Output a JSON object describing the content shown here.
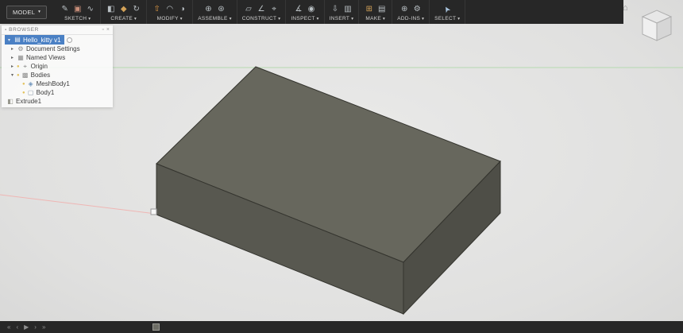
{
  "ui": {
    "caret": "▾",
    "arrow_collapsed": "▸",
    "arrow_expanded": "▾",
    "bulb": {
      "glyph": "●",
      "color": "#e3c25c"
    }
  },
  "colors": {
    "toolbar_bg": "#272727",
    "timeline_bg": "#272727",
    "canvas_bg": "#e4e4e3",
    "selection": "#4a80c4",
    "box_top": "#67675d",
    "box_front": "#585850",
    "box_right": "#4e4e47",
    "box_edge": "#34342e",
    "axis_x": "#efb6b4",
    "axis_z": "#b5d9b0",
    "viewcube_top": "#e9e9e9",
    "viewcube_front": "#f3f3f3",
    "viewcube_right": "#d6d6d6"
  },
  "toolbar": {
    "workspace_label": "MODEL",
    "groups": [
      {
        "label": "SKETCH",
        "icons": [
          {
            "glyph": "✎",
            "color": "#b9c0c4"
          },
          {
            "glyph": "▣",
            "color": "#c98f7a"
          },
          {
            "glyph": "∿",
            "color": "#b9c0c4"
          }
        ]
      },
      {
        "label": "CREATE",
        "icons": [
          {
            "glyph": "◧",
            "color": "#b9c0c4"
          },
          {
            "glyph": "◆",
            "color": "#d3a258"
          },
          {
            "glyph": "↻",
            "color": "#b9c0c4"
          }
        ]
      },
      {
        "label": "MODIFY",
        "icons": [
          {
            "glyph": "⇧",
            "color": "#e09a44"
          },
          {
            "glyph": "◠",
            "color": "#b9c0c4"
          },
          {
            "glyph": "◑",
            "color": "#b9c0c4"
          }
        ]
      },
      {
        "label": "ASSEMBLE",
        "icons": [
          {
            "glyph": "⊕",
            "color": "#b9c0c4"
          },
          {
            "glyph": "⊛",
            "color": "#b9c0c4"
          }
        ]
      },
      {
        "label": "CONSTRUCT",
        "icons": [
          {
            "glyph": "▱",
            "color": "#b9c0c4"
          },
          {
            "glyph": "∠",
            "color": "#b9c0c4"
          },
          {
            "glyph": "⌖",
            "color": "#b9c0c4"
          }
        ]
      },
      {
        "label": "INSPECT",
        "icons": [
          {
            "glyph": "∡",
            "color": "#b9c0c4"
          },
          {
            "glyph": "◉",
            "color": "#b9c0c4"
          }
        ]
      },
      {
        "label": "INSERT",
        "icons": [
          {
            "glyph": "⇩",
            "color": "#b9c0c4"
          },
          {
            "glyph": "▥",
            "color": "#b9c0c4"
          }
        ]
      },
      {
        "label": "MAKE",
        "icons": [
          {
            "glyph": "⊞",
            "color": "#d3a258"
          },
          {
            "glyph": "▤",
            "color": "#b9c0c4"
          }
        ]
      },
      {
        "label": "ADD-INS",
        "icons": [
          {
            "glyph": "⊕",
            "color": "#b9c0c4"
          },
          {
            "glyph": "⚙",
            "color": "#b9c0c4"
          }
        ]
      },
      {
        "label": "SELECT",
        "icons": [
          {
            "glyph": "➤",
            "color": "#a9c4de"
          }
        ]
      }
    ]
  },
  "browser": {
    "title": "BROWSER",
    "grip_glyph": "▪",
    "options_glyph": "▫",
    "close_glyph": "×",
    "root_label": "Hello_kitty v1",
    "root_icon_glyph": "▤",
    "root_icon_color": "#eaf0f7",
    "items": [
      {
        "label": "Document Settings",
        "icon_glyph": "⚙",
        "icon_color": "#8a8a8a"
      },
      {
        "label": "Named Views",
        "icon_glyph": "▦",
        "icon_color": "#8a8a8a"
      },
      {
        "label": "Origin",
        "icon_glyph": "⌖",
        "icon_color": "#8a8a8a"
      },
      {
        "label": "Bodies",
        "icon_glyph": "▩",
        "icon_color": "#8a8a8a"
      },
      {
        "label": "MeshBody1",
        "icon_glyph": "◈",
        "icon_color": "#6f94bb"
      },
      {
        "label": "Body1",
        "icon_glyph": "▢",
        "icon_color": "#8a98a8"
      },
      {
        "label": "Extrude1",
        "icon_glyph": "◧",
        "icon_color": "#98988e"
      }
    ]
  },
  "timeline": {
    "controls": [
      {
        "glyph": "«"
      },
      {
        "glyph": "‹"
      },
      {
        "glyph": "▶"
      },
      {
        "glyph": "›"
      },
      {
        "glyph": "»"
      }
    ]
  },
  "viewcube": {
    "home_glyph": "⌂"
  }
}
